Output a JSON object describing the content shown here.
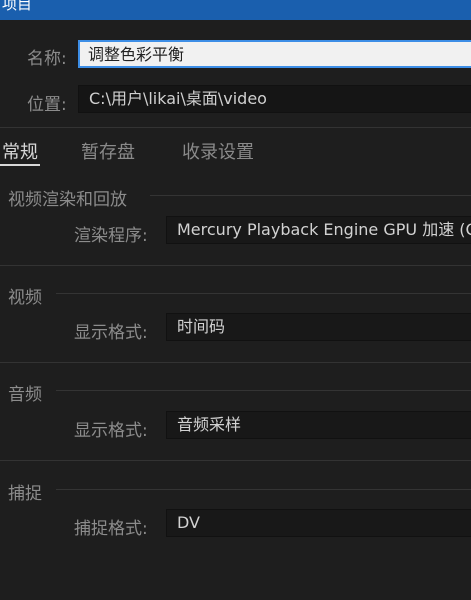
{
  "window": {
    "title": "项目"
  },
  "form": {
    "name_label": "名称:",
    "name_value": "调整色彩平衡",
    "location_label": "位置:",
    "location_value": "C:\\用户\\likai\\桌面\\video"
  },
  "tabs": [
    {
      "label": "常规",
      "active": true
    },
    {
      "label": "暂存盘",
      "active": false
    },
    {
      "label": "收录设置",
      "active": false
    }
  ],
  "sections": {
    "render": {
      "title": "视频渲染和回放",
      "renderer_label": "渲染程序:",
      "renderer_value": "Mercury Playback Engine GPU 加速 (OpenCL)"
    },
    "video": {
      "title": "视频",
      "format_label": "显示格式:",
      "format_value": "时间码"
    },
    "audio": {
      "title": "音频",
      "format_label": "显示格式:",
      "format_value": "音频采样"
    },
    "capture": {
      "title": "捕捉",
      "format_label": "捕捉格式:",
      "format_value": "DV"
    }
  },
  "colors": {
    "titlebar": "#1a5fae",
    "background": "#1e1e1e",
    "focus_border": "#3d8ee6"
  }
}
